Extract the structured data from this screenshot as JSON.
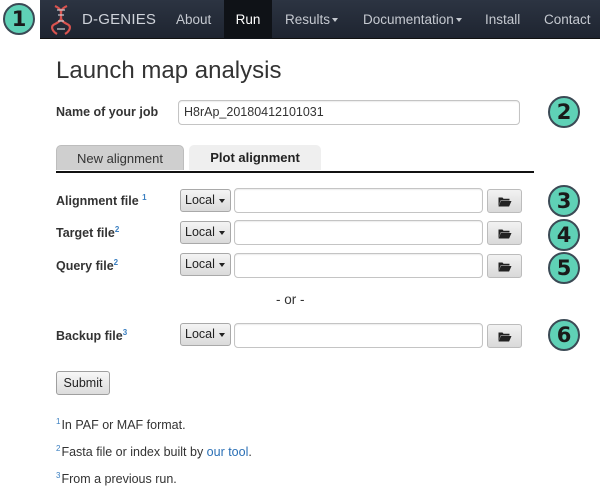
{
  "app": {
    "brand": "D-GENIES",
    "nav": [
      {
        "label": "About",
        "active": false,
        "dropdown": false
      },
      {
        "label": "Run",
        "active": true,
        "dropdown": false
      },
      {
        "label": "Results",
        "active": false,
        "dropdown": true
      },
      {
        "label": "Documentation",
        "active": false,
        "dropdown": true
      },
      {
        "label": "Install",
        "active": false,
        "dropdown": false
      },
      {
        "label": "Contact",
        "active": false,
        "dropdown": false
      }
    ]
  },
  "badges": [
    "1",
    "2",
    "3",
    "4",
    "5",
    "6"
  ],
  "page": {
    "title": "Launch map analysis",
    "job_label": "Name of your job",
    "job_value": "H8rAp_20180412101031",
    "tabs": [
      {
        "label": "New alignment",
        "active": false
      },
      {
        "label": "Plot alignment",
        "active": true
      }
    ],
    "files": [
      {
        "label": "Alignment file",
        "sup": "1",
        "source": "Local",
        "value": ""
      },
      {
        "label": "Target file",
        "sup": "2",
        "source": "Local",
        "value": ""
      },
      {
        "label": "Query file",
        "sup": "2",
        "source": "Local",
        "value": ""
      }
    ],
    "or_text": "- or -",
    "backup": {
      "label": "Backup file",
      "sup": "3",
      "source": "Local",
      "value": ""
    },
    "submit": "Submit",
    "footnotes": {
      "n1": {
        "sup": "1",
        "text": "In PAF or MAF format."
      },
      "n2": {
        "sup": "2",
        "text": "Fasta file or index built by ",
        "link": "our tool",
        "after": "."
      },
      "n3": {
        "sup": "3",
        "text": "From a previous run."
      }
    }
  },
  "colors": {
    "navbar": "#222a36",
    "badge": "#5fd1b6",
    "link": "#2a6fb5",
    "brand_red": "#d9534f"
  }
}
